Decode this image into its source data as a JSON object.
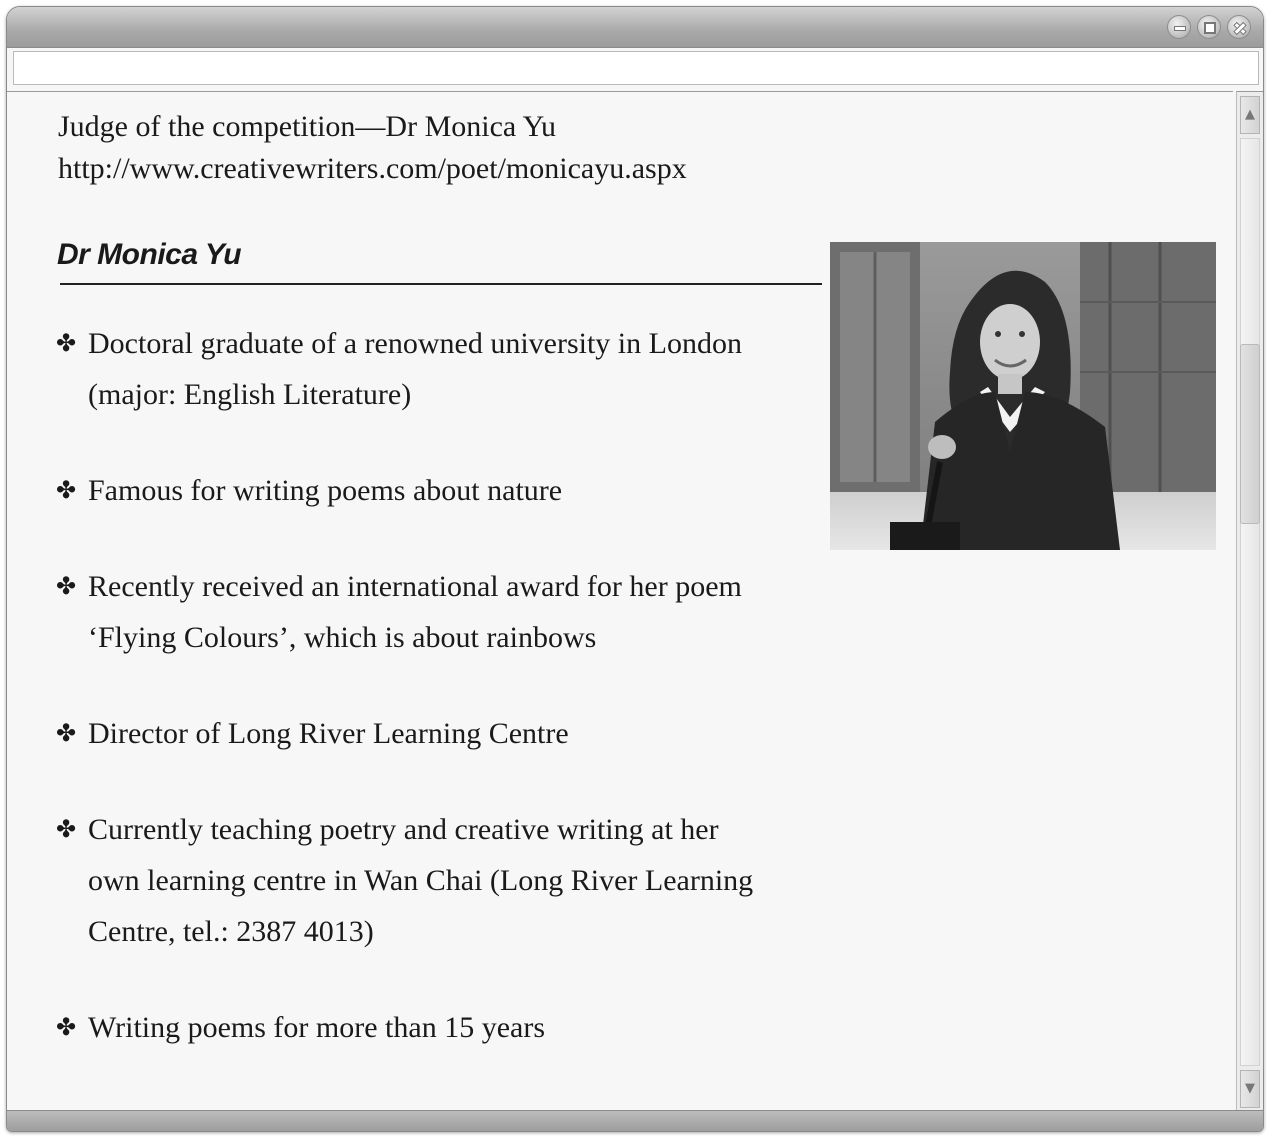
{
  "window": {
    "address_value": ""
  },
  "header": {
    "line1": "Judge of the competition—Dr Monica Yu",
    "line2": "http://www.creativewriters.com/poet/monicayu.aspx"
  },
  "profile": {
    "heading": "Dr Monica Yu",
    "bullet_glyph": "✤",
    "bullets": [
      {
        "line1": "Doctoral graduate of a renowned university in London",
        "line2": "(major: English Literature)"
      },
      {
        "line1": "Famous for writing poems about nature"
      },
      {
        "line1": "Recently received an international award for her poem",
        "line2": "‘Flying Colours’, which is about rainbows"
      },
      {
        "line1": "Director of Long River Learning Centre"
      },
      {
        "line1": "Currently teaching poetry and creative writing at her",
        "line2": "own learning centre in Wan Chai (Long River Learning",
        "line3": "Centre, tel.: 2387 4013)"
      },
      {
        "line1": "Writing poems for more than 15 years"
      }
    ]
  },
  "icons": {
    "minimize": "minimize-icon",
    "maximize": "maximize-icon",
    "close": "close-icon",
    "scroll_up": "arrow-up-icon",
    "scroll_down": "arrow-down-icon"
  },
  "scroll": {
    "up_glyph": "▲",
    "down_glyph": "▼"
  }
}
